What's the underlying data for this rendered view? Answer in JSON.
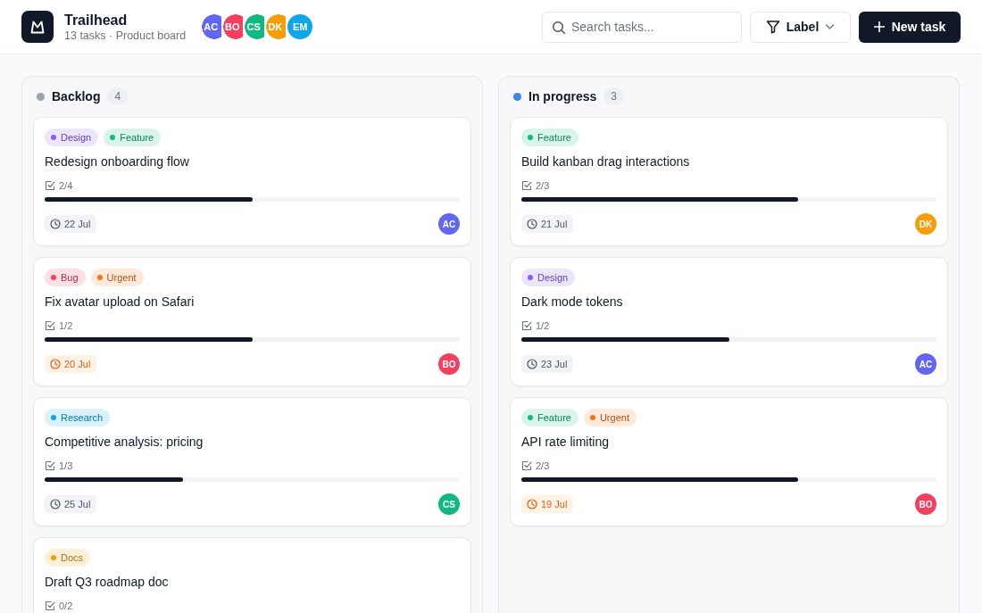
{
  "app": {
    "title": "Trailhead",
    "subtitle": "13 tasks · Product board"
  },
  "members": [
    {
      "initials": "AC",
      "color": "#6366f1"
    },
    {
      "initials": "BO",
      "color": "#f43f5e"
    },
    {
      "initials": "CS",
      "color": "#10b981"
    },
    {
      "initials": "DK",
      "color": "#f59e0b"
    },
    {
      "initials": "EM",
      "color": "#0ea5e9"
    }
  ],
  "search": {
    "placeholder": "Search tasks..."
  },
  "filter_button": {
    "label": "Label"
  },
  "new_task_button": {
    "label": "New task"
  },
  "columns": [
    {
      "name": "Backlog",
      "color": "#9ca3af",
      "count": "4",
      "cards": [
        {
          "tags": [
            {
              "label": "Design",
              "color": "#8b5cf6"
            },
            {
              "label": "Feature",
              "color": "#10b981"
            }
          ],
          "title": "Redesign onboarding flow",
          "checklist": "2/4",
          "level": 0.5,
          "due": {
            "date": "22 Jul",
            "overdue": false
          },
          "assignee": {
            "initials": "AC",
            "color": "#6366f1"
          }
        },
        {
          "tags": [
            {
              "label": "Bug",
              "color": "#f43f5e"
            },
            {
              "label": "Urgent",
              "color": "#f97316"
            }
          ],
          "title": "Fix avatar upload on Safari",
          "checklist": "1/2",
          "level": 0.5,
          "due": {
            "date": "20 Jul",
            "overdue": true
          },
          "assignee": {
            "initials": "BO",
            "color": "#f43f5e"
          }
        },
        {
          "tags": [
            {
              "label": "Research",
              "color": "#0ea5e9"
            }
          ],
          "title": "Competitive analysis: pricing",
          "checklist": "1/3",
          "level": 0.333,
          "due": {
            "date": "25 Jul",
            "overdue": false
          },
          "assignee": {
            "initials": "CS",
            "color": "#10b981"
          }
        },
        {
          "tags": [
            {
              "label": "Docs",
              "color": "#f59e0b"
            }
          ],
          "title": "Draft Q3 roadmap doc",
          "checklist": "0/2"
        }
      ]
    },
    {
      "name": "In progress",
      "color": "#3b82f6",
      "count": "3",
      "cards": [
        {
          "tags": [
            {
              "label": "Feature",
              "color": "#10b981"
            }
          ],
          "title": "Build kanban drag interactions",
          "checklist": "2/3",
          "level": 0.667,
          "due": {
            "date": "21 Jul",
            "overdue": false
          },
          "assignee": {
            "initials": "DK",
            "color": "#f59e0b"
          }
        },
        {
          "tags": [
            {
              "label": "Design",
              "color": "#8b5cf6"
            }
          ],
          "title": "Dark mode tokens",
          "checklist": "1/2",
          "level": 0.5,
          "due": {
            "date": "23 Jul",
            "overdue": false
          },
          "assignee": {
            "initials": "AC",
            "color": "#6366f1"
          }
        },
        {
          "tags": [
            {
              "label": "Feature",
              "color": "#10b981"
            },
            {
              "label": "Urgent",
              "color": "#f97316"
            }
          ],
          "title": "API rate limiting",
          "checklist": "2/3",
          "level": 0.667,
          "due": {
            "date": "19 Jul",
            "overdue": true
          },
          "assignee": {
            "initials": "BO",
            "color": "#f43f5e"
          }
        }
      ]
    }
  ]
}
